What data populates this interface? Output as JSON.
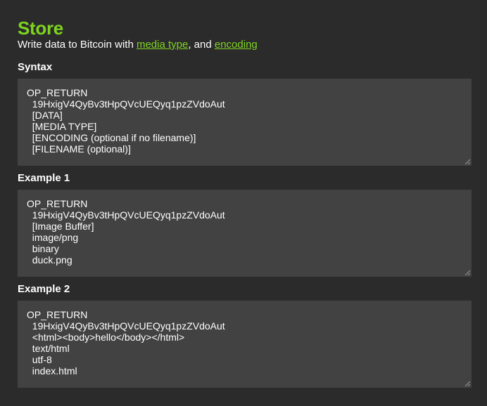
{
  "header": {
    "title": "Store",
    "subtitle_prefix": "Write data to Bitcoin with ",
    "link_media_type": "media type",
    "subtitle_mid": ", and ",
    "link_encoding": "encoding"
  },
  "sections": [
    {
      "label": "Syntax",
      "lines": [
        "OP_RETURN",
        "  19HxigV4QyBv3tHpQVcUEQyq1pzZVdoAut",
        "  [DATA]",
        "  [MEDIA TYPE]",
        "  [ENCODING (optional if no filename)]",
        "  [FILENAME (optional)]"
      ]
    },
    {
      "label": "Example 1",
      "lines": [
        "OP_RETURN",
        "  19HxigV4QyBv3tHpQVcUEQyq1pzZVdoAut",
        "  [Image Buffer]",
        "  image/png",
        "  binary",
        "  duck.png"
      ]
    },
    {
      "label": "Example 2",
      "lines": [
        "OP_RETURN",
        "  19HxigV4QyBv3tHpQVcUEQyq1pzZVdoAut",
        "  <html><body>hello</body></html>",
        "  text/html",
        "  utf-8",
        "  index.html"
      ]
    }
  ],
  "icons": {
    "resize": "resize-grip-icon"
  },
  "colors": {
    "background": "#2b2b2b",
    "accent": "#7ed321",
    "textarea_bg": "#424242"
  }
}
